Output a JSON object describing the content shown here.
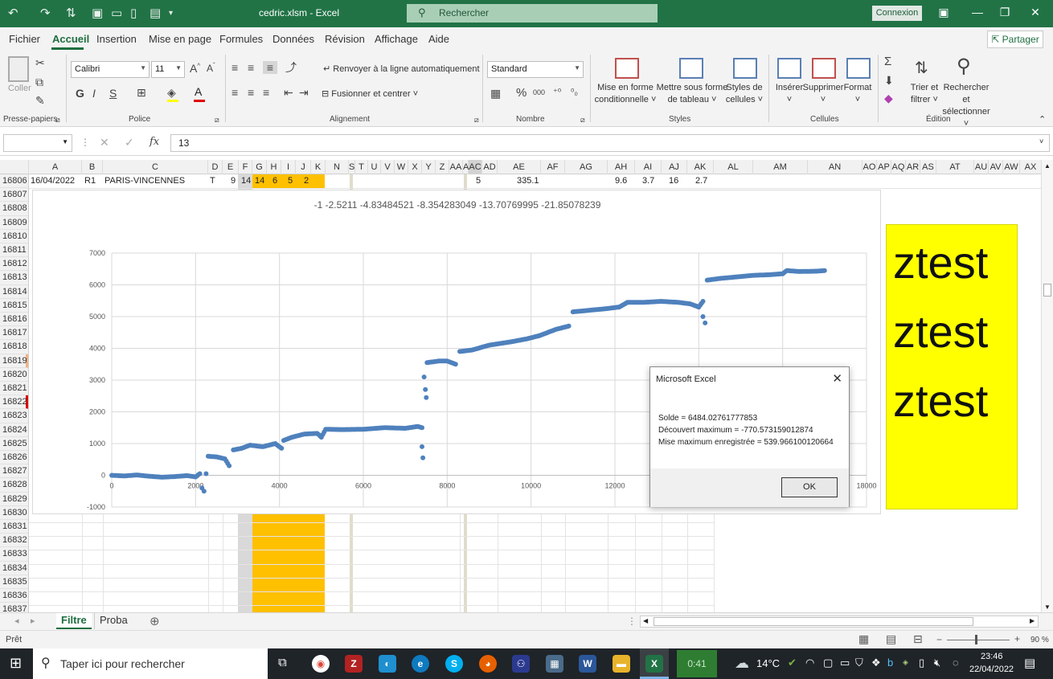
{
  "window": {
    "title": "cedric.xlsm  -  Excel",
    "search_placeholder": "Rechercher",
    "connexion_label": "Connexion"
  },
  "menu": {
    "tabs": [
      "Fichier",
      "Accueil",
      "Insertion",
      "Mise en page",
      "Formules",
      "Données",
      "Révision",
      "Affichage",
      "Aide"
    ],
    "active": "Accueil",
    "share_label": "Partager"
  },
  "ribbon": {
    "clipboard": {
      "paste_label": "Coller",
      "group_label": "Presse-papiers"
    },
    "font": {
      "name": "Calibri",
      "size": "11",
      "bold": "G",
      "italic": "I",
      "underline": "S",
      "group_label": "Police"
    },
    "alignment": {
      "wrap_label": "Renvoyer à la ligne automatiquement",
      "merge_label": "Fusionner et centrer",
      "group_label": "Alignement"
    },
    "number": {
      "format": "Standard",
      "percent": "%",
      "thousands": "000",
      "group_label": "Nombre"
    },
    "styles": {
      "conditional_l1": "Mise en forme",
      "conditional_l2": "conditionnelle",
      "table_l1": "Mettre sous forme",
      "table_l2": "de tableau",
      "cell_l1": "Styles de",
      "cell_l2": "cellules",
      "group_label": "Styles"
    },
    "cells": {
      "insert": "Insérer",
      "delete": "Supprimer",
      "format": "Format",
      "group_label": "Cellules"
    },
    "editing": {
      "sort_l1": "Trier et",
      "sort_l2": "filtrer",
      "find_l1": "Rechercher et",
      "find_l2": "sélectionner",
      "group_label": "Édition"
    }
  },
  "formula_bar": {
    "fx": "fx",
    "value": "13"
  },
  "columns": [
    "A",
    "B",
    "C",
    "D",
    "E",
    "F",
    "G",
    "H",
    "I",
    "J",
    "K",
    "N",
    "S",
    "T",
    "U",
    "V",
    "W",
    "X",
    "Y",
    "Z",
    "AA",
    "A",
    "AC",
    "AD",
    "AE",
    "AF",
    "AG",
    "AH",
    "AI",
    "AJ",
    "AK",
    "AL",
    "AM",
    "AN",
    "AO",
    "AP",
    "AQ",
    "AR",
    "AS",
    "AT",
    "AU",
    "AV",
    "AW",
    "AX"
  ],
  "rows": [
    "16806",
    "16807",
    "16808",
    "16809",
    "16810",
    "16811",
    "16812",
    "16813",
    "16814",
    "16815",
    "16816",
    "16817",
    "16818",
    "16819",
    "16820",
    "16821",
    "16822",
    "16823",
    "16824",
    "16825",
    "16826",
    "16827",
    "16828",
    "16829",
    "16830",
    "16831",
    "16832",
    "16833",
    "16834",
    "16835",
    "16836",
    "16837"
  ],
  "row_16806": {
    "A": "16/04/2022",
    "B": "R1",
    "C": "PARIS-VINCENNES",
    "D": "T",
    "E": "9",
    "F": "14",
    "G": "14",
    "H": "6",
    "I": "5",
    "J": "2",
    "AC": "5",
    "AE": "335.1",
    "AH": "9.6",
    "AI": "3.7",
    "AJ": "16",
    "AK": "2.7"
  },
  "chart_data": {
    "type": "scatter",
    "title": "-1 -2.5211 -4.83484521 -8.354283049 -13.70769995 -21.85078239",
    "xlim": [
      0,
      18000
    ],
    "ylim": [
      -1000,
      7000
    ],
    "x_ticks": [
      0,
      2000,
      4000,
      6000,
      8000,
      10000,
      12000,
      14000,
      16000,
      18000
    ],
    "y_ticks": [
      -1000,
      0,
      1000,
      2000,
      3000,
      4000,
      5000,
      6000,
      7000
    ],
    "grid": true,
    "series": [
      {
        "color": "#4f81bd",
        "points": [
          [
            0,
            0
          ],
          [
            300,
            -20
          ],
          [
            600,
            10
          ],
          [
            900,
            -30
          ],
          [
            1200,
            -60
          ],
          [
            1500,
            -40
          ],
          [
            1800,
            -10
          ],
          [
            2000,
            -50
          ],
          [
            2100,
            50
          ],
          [
            2150,
            -400
          ],
          [
            2200,
            -500
          ],
          [
            2250,
            50
          ],
          [
            2300,
            600
          ],
          [
            2500,
            580
          ],
          [
            2700,
            520
          ],
          [
            2800,
            300
          ],
          [
            2900,
            800
          ],
          [
            3100,
            850
          ],
          [
            3300,
            950
          ],
          [
            3600,
            900
          ],
          [
            3900,
            1000
          ],
          [
            4050,
            850
          ],
          [
            4100,
            1100
          ],
          [
            4300,
            1200
          ],
          [
            4600,
            1300
          ],
          [
            4900,
            1320
          ],
          [
            5000,
            1200
          ],
          [
            5100,
            1450
          ],
          [
            5500,
            1440
          ],
          [
            6000,
            1450
          ],
          [
            6500,
            1500
          ],
          [
            7000,
            1480
          ],
          [
            7300,
            1540
          ],
          [
            7400,
            1500
          ],
          [
            7400,
            900
          ],
          [
            7420,
            550
          ],
          [
            7450,
            3100
          ],
          [
            7480,
            2700
          ],
          [
            7500,
            2450
          ],
          [
            7520,
            3550
          ],
          [
            7800,
            3600
          ],
          [
            8000,
            3600
          ],
          [
            8200,
            3500
          ],
          [
            8300,
            3900
          ],
          [
            8600,
            3950
          ],
          [
            9000,
            4100
          ],
          [
            9500,
            4200
          ],
          [
            9900,
            4300
          ],
          [
            10200,
            4400
          ],
          [
            10600,
            4600
          ],
          [
            10900,
            4700
          ],
          [
            11000,
            5150
          ],
          [
            11400,
            5200
          ],
          [
            11800,
            5250
          ],
          [
            12100,
            5300
          ],
          [
            12300,
            5450
          ],
          [
            12700,
            5450
          ],
          [
            13100,
            5480
          ],
          [
            13500,
            5450
          ],
          [
            13800,
            5400
          ],
          [
            14000,
            5300
          ],
          [
            14100,
            5480
          ],
          [
            14100,
            5000
          ],
          [
            14150,
            4800
          ],
          [
            14200,
            6150
          ],
          [
            14500,
            6200
          ],
          [
            14900,
            6250
          ],
          [
            15300,
            6300
          ],
          [
            15700,
            6320
          ],
          [
            16000,
            6350
          ],
          [
            16100,
            6450
          ],
          [
            16400,
            6420
          ],
          [
            16800,
            6430
          ],
          [
            17000,
            6450
          ]
        ]
      }
    ]
  },
  "yellow_box": {
    "lines": [
      "ztest",
      "ztest",
      "ztest"
    ]
  },
  "dialog": {
    "title": "Microsoft Excel",
    "lines": [
      "Solde = 6484.02761777853",
      "Découvert maximum = -770.573159012874",
      "Mise maximum enregistrée = 539.966100120664"
    ],
    "ok_label": "OK"
  },
  "sheets": {
    "tabs": [
      "Filtre",
      "Proba"
    ],
    "active": "Filtre"
  },
  "status": {
    "ready": "Prêt",
    "zoom": "90 %"
  },
  "taskbar": {
    "search_placeholder": "Taper ici pour rechercher",
    "timer": "0:41",
    "weather": "14°C",
    "time": "23:46",
    "date": "22/04/2022"
  }
}
